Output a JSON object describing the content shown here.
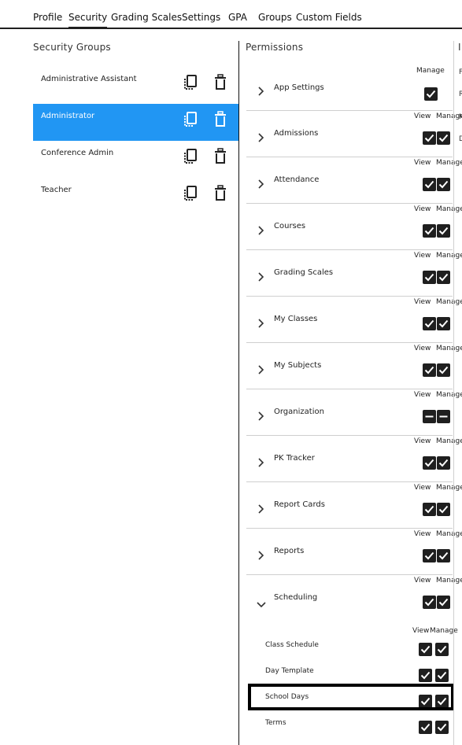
{
  "tabs": [
    "Profile",
    "Security",
    "Grading Scales",
    "Settings",
    "GPA",
    "Groups",
    "Custom Fields"
  ],
  "active_tab": "Security",
  "security_groups": {
    "title": "Security Groups",
    "items": [
      "Administrative Assistant",
      "Administrator",
      "Conference Admin",
      "Teacher"
    ],
    "selected": "Administrator"
  },
  "permissions": {
    "title": "Permissions",
    "view_label": "View",
    "manage_label": "Manage",
    "rows": [
      {
        "label": "App Settings",
        "has_view": false,
        "view": "none",
        "manage": "checked",
        "expanded": false
      },
      {
        "label": "Admissions",
        "has_view": true,
        "view": "checked",
        "manage": "checked",
        "expanded": false
      },
      {
        "label": "Attendance",
        "has_view": true,
        "view": "checked",
        "manage": "checked",
        "expanded": false
      },
      {
        "label": "Courses",
        "has_view": true,
        "view": "checked",
        "manage": "checked",
        "expanded": false
      },
      {
        "label": "Grading Scales",
        "has_view": true,
        "view": "checked",
        "manage": "checked",
        "expanded": false
      },
      {
        "label": "My Classes",
        "has_view": true,
        "view": "checked",
        "manage": "checked",
        "expanded": false
      },
      {
        "label": "My Subjects",
        "has_view": true,
        "view": "checked",
        "manage": "checked",
        "expanded": false
      },
      {
        "label": "Organization",
        "has_view": true,
        "view": "indeterminate",
        "manage": "indeterminate",
        "expanded": false
      },
      {
        "label": "PK Tracker",
        "has_view": true,
        "view": "checked",
        "manage": "checked",
        "expanded": false
      },
      {
        "label": "Report Cards",
        "has_view": true,
        "view": "checked",
        "manage": "checked",
        "expanded": false
      },
      {
        "label": "Reports",
        "has_view": true,
        "view": "checked",
        "manage": "checked",
        "expanded": false
      },
      {
        "label": "Scheduling",
        "has_view": true,
        "view": "checked",
        "manage": "checked",
        "expanded": true
      }
    ],
    "scheduling_children": [
      {
        "label": "Class Schedule",
        "view": "checked",
        "manage": "checked"
      },
      {
        "label": "Day Template",
        "view": "checked",
        "manage": "checked"
      },
      {
        "label": "School Days",
        "view": "checked",
        "manage": "checked",
        "highlighted": true
      },
      {
        "label": "Terms",
        "view": "checked",
        "manage": "checked"
      }
    ]
  },
  "right_panel_partial": {
    "title": "I",
    "letters": [
      "F",
      "R",
      "N",
      "D"
    ]
  }
}
